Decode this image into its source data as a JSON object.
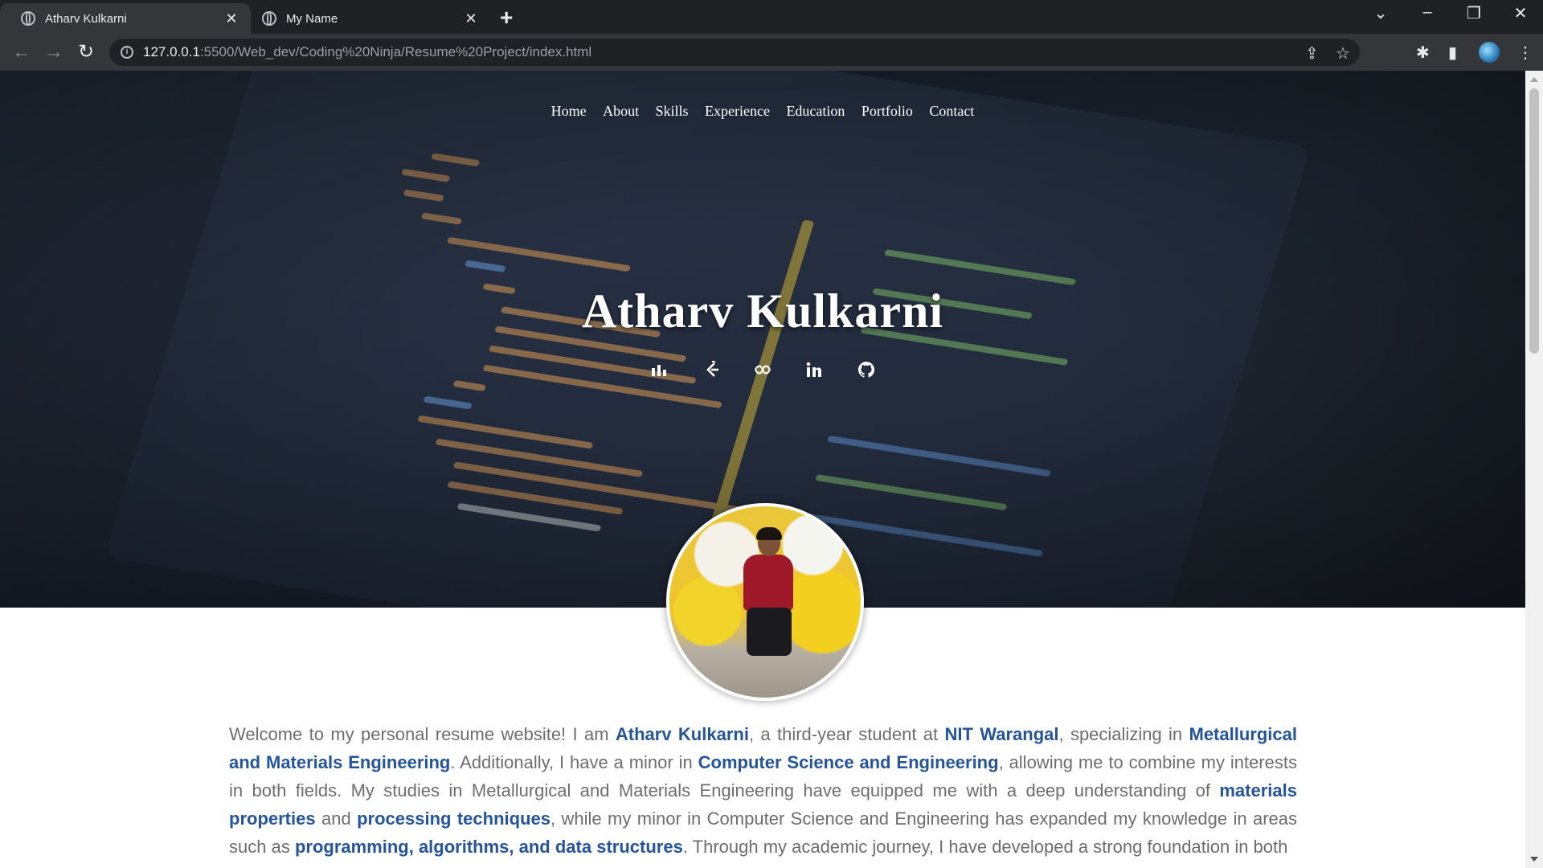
{
  "browser": {
    "tabs": [
      {
        "title": "Atharv Kulkarni",
        "active": true
      },
      {
        "title": "My Name",
        "active": false
      }
    ],
    "url_host": "127.0.0.1",
    "url_path": ":5500/Web_dev/Coding%20Ninja/Resume%20Project/index.html"
  },
  "nav": {
    "items": [
      "Home",
      "About",
      "Skills",
      "Experience",
      "Education",
      "Portfolio",
      "Contact"
    ]
  },
  "hero": {
    "name": "Atharv Kulkarni",
    "socials": [
      "leetcode-icon",
      "codechef-icon",
      "codeforces-icon",
      "linkedin-icon",
      "github-icon"
    ]
  },
  "about": {
    "p1": "Welcome to my personal resume website! I am ",
    "name": "Atharv Kulkarni",
    "p2": ", a third-year student at ",
    "college": "NIT Warangal",
    "p3": ", specializing in ",
    "major": "Metallurgical and Materials Engineering",
    "p4": ". Additionally, I have a minor in ",
    "minor": "Computer Science and Engineering",
    "p5": ", allowing me to combine my interests in both fields. My studies in Metallurgical and Materials Engineering have equipped me with a deep understanding of ",
    "k1": "materials properties",
    "p6": " and ",
    "k2": "processing techniques",
    "p7": ", while my minor in Computer Science and Engineering has expanded my knowledge in areas such as ",
    "k3": "programming, algorithms, and data structures",
    "p8": ". Through my academic journey, I have developed a strong foundation in both"
  },
  "colors": {
    "accent": "#24549a",
    "body_text": "#6d6d6d",
    "chrome_dark": "#202124",
    "chrome_mid": "#35363a"
  }
}
